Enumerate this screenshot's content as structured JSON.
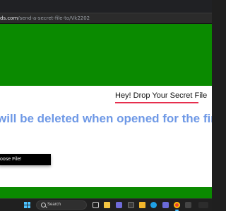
{
  "browser": {
    "url_domain": "ds.com",
    "url_path": "/send-a-secret-file-to/Vk2202"
  },
  "page": {
    "heading": "Hey! Drop Your Secret File",
    "notice": "will be deleted when opened for the first",
    "choose_button_label": "oose File!"
  },
  "colors": {
    "green": "#0a8a00",
    "heading_underline": "#e62e4d",
    "notice_text": "#6f99e6",
    "button_bg": "#000000"
  },
  "taskbar": {
    "search_label": "Search",
    "icons": [
      "windows-start-icon",
      "search-icon",
      "task-view-icon",
      "file-explorer-icon",
      "teams-icon",
      "app-icon",
      "folder-icon",
      "edge-icon",
      "store-icon",
      "chrome-icon",
      "app-icon",
      "system-tray-icon"
    ]
  }
}
